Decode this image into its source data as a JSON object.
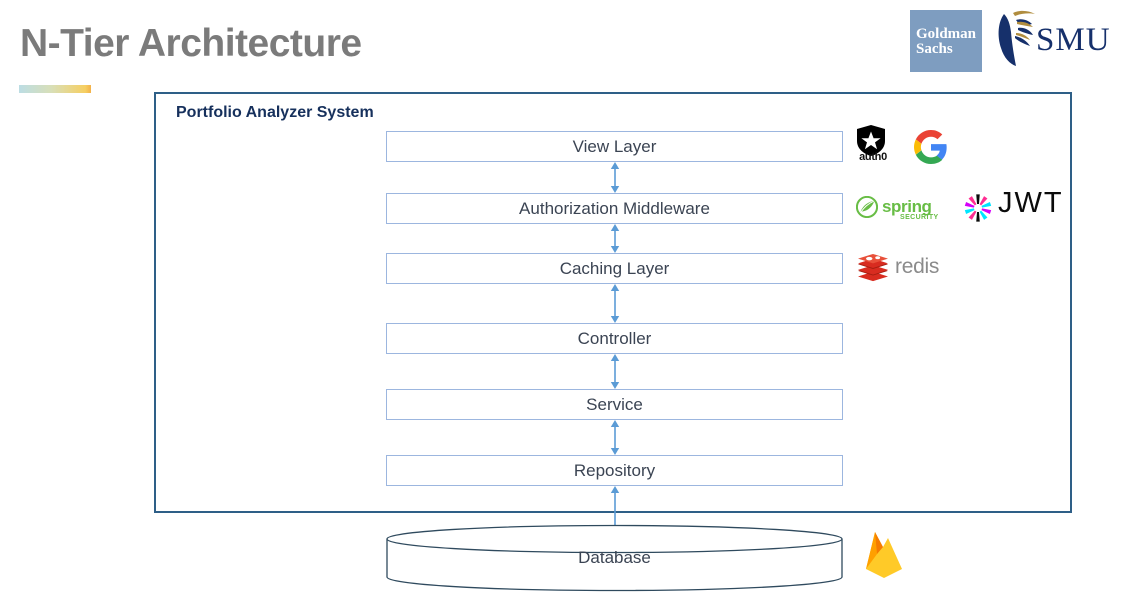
{
  "slide": {
    "title": "N-Tier Architecture",
    "accent_gradient_from": "#bcdde4",
    "accent_gradient_to": "#f3b24a"
  },
  "brands": [
    {
      "name": "goldman-sachs",
      "line1": "Goldman",
      "line2": "Sachs",
      "box_color": "#7e9dc0",
      "text_color": "#ffffff"
    },
    {
      "name": "smu",
      "wordmark": "SMU",
      "mark_color": "#16306b",
      "accent_color": "#b08d3f"
    }
  ],
  "system": {
    "title": "Portfolio Analyzer System",
    "border_color": "#2e5f87",
    "title_color": "#16305c"
  },
  "layers": [
    {
      "id": "view-layer",
      "label": "View Layer"
    },
    {
      "id": "authorization-middleware",
      "label": "Authorization Middleware"
    },
    {
      "id": "caching-layer",
      "label": "Caching Layer"
    },
    {
      "id": "controller",
      "label": "Controller"
    },
    {
      "id": "service",
      "label": "Service"
    },
    {
      "id": "repository",
      "label": "Repository"
    }
  ],
  "layer_box_style": {
    "border_color": "#9cb6df",
    "text_color": "#3b4453",
    "fill": "#ffffff"
  },
  "connectors": {
    "arrow_color": "#5b9bd5",
    "style": "double-headed-vertical",
    "count": 6
  },
  "database": {
    "label": "Database",
    "shape": "cylinder",
    "border_color": "#2f4a5e",
    "fill": "#ffffff"
  },
  "tech_logos": [
    {
      "row": "view-layer",
      "items": [
        {
          "name": "auth0-logo",
          "label": "auth0",
          "color": "#000000"
        },
        {
          "name": "google-logo",
          "label": "G",
          "colors": [
            "#ea4335",
            "#fbbc05",
            "#34a853",
            "#4285f4"
          ]
        }
      ]
    },
    {
      "row": "authorization-middleware",
      "items": [
        {
          "name": "spring-security-logo",
          "label": "spring",
          "sublabel": "SECURITY",
          "color": "#68bd45"
        },
        {
          "name": "jwt-logo",
          "label": "JWT",
          "color": "#0b0b0b",
          "accents": [
            "#ff2d92",
            "#00e5ff",
            "#d500f9"
          ]
        }
      ]
    },
    {
      "row": "caching-layer",
      "items": [
        {
          "name": "redis-logo",
          "label": "redis",
          "color": "#8b8b8b",
          "mark_color": "#d82c20"
        }
      ]
    },
    {
      "row": "database",
      "items": [
        {
          "name": "firebase-logo",
          "label": "",
          "colors": [
            "#ffca28",
            "#ffa000",
            "#f57c00"
          ]
        }
      ]
    }
  ]
}
